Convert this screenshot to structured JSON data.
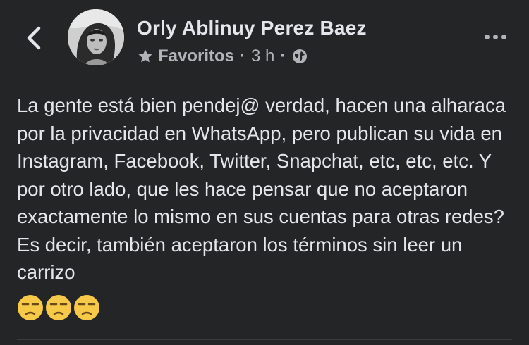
{
  "header": {
    "back_icon": "chevron-left-icon",
    "author_name": "Orly Ablinuy Perez Baez",
    "audience_label": "Favoritos",
    "separator": "·",
    "timestamp": "3 h",
    "privacy_icon": "globe-icon",
    "more_icon": "more-horizontal-icon"
  },
  "post": {
    "text": "La gente está bien pendej@ verdad, hacen una alharaca por la privacidad en WhatsApp, pero publican su vida en Instagram, Facebook, Twitter, Snapchat, etc, etc, etc. Y por otro lado, que les hace pensar que no aceptaron exactamente lo mismo en sus cuentas para otras redes? Es decir, también aceptaron los términos sin leer un carrizo",
    "emojis": [
      "😒",
      "😒",
      "😒"
    ]
  },
  "colors": {
    "background": "#242526",
    "primary_text": "#e4e6eb",
    "secondary_text": "#b0b3b8",
    "emoji_face": "#f7c948"
  }
}
